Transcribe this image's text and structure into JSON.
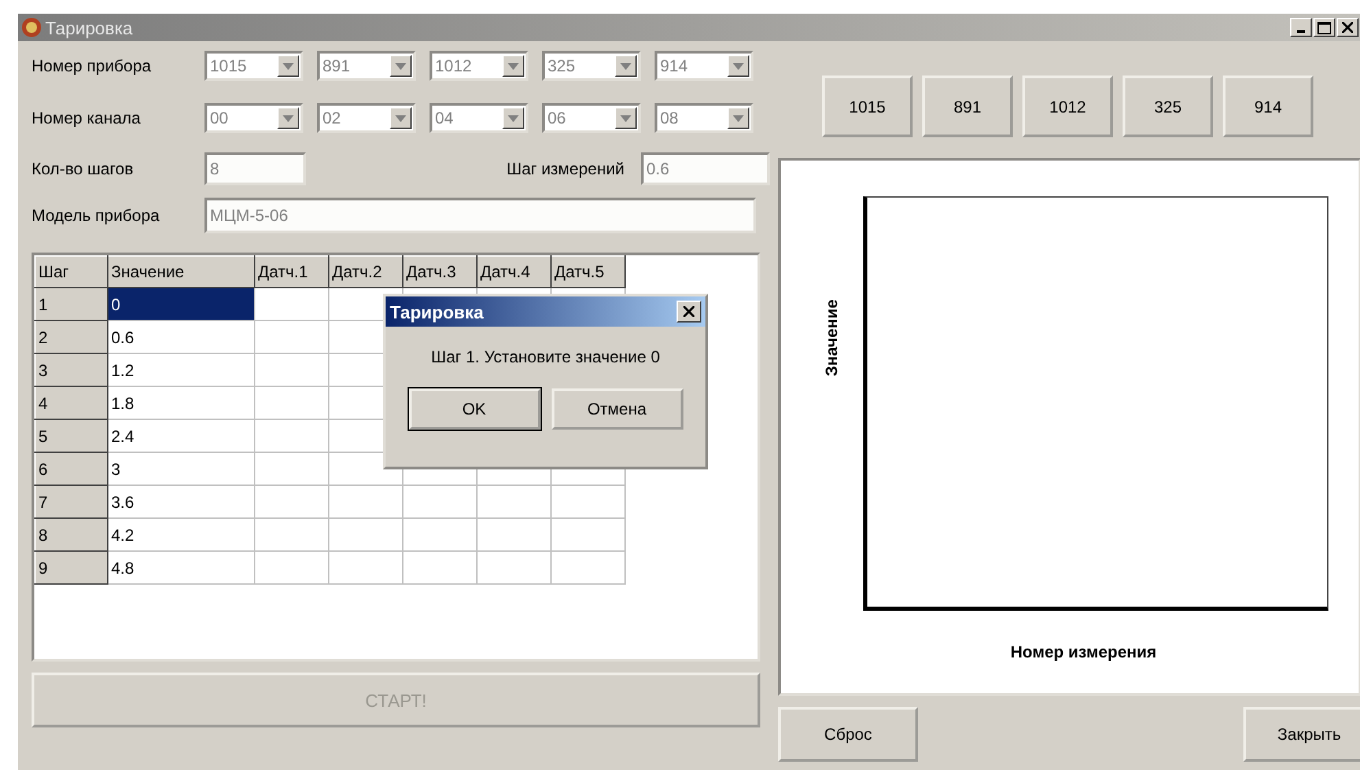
{
  "window": {
    "title": "Тарировка"
  },
  "device_row": {
    "label": "Номер прибора",
    "combos": [
      {
        "value": "1015"
      },
      {
        "value": "891"
      },
      {
        "value": "1012"
      },
      {
        "value": "325"
      },
      {
        "value": "914"
      }
    ]
  },
  "channel_row": {
    "label": "Номер канала",
    "combos": [
      {
        "value": "00"
      },
      {
        "value": "02"
      },
      {
        "value": "04"
      },
      {
        "value": "06"
      },
      {
        "value": "08"
      }
    ]
  },
  "steps_count": {
    "label": "Кол-во шагов",
    "value": "8",
    "disabled": true
  },
  "measure_step": {
    "label": "Шаг измерений",
    "value": "0.6",
    "disabled": true
  },
  "model": {
    "label": "Модель прибора",
    "value": "МЦМ-5-06",
    "disabled": true
  },
  "table": {
    "columns": [
      "Шаг",
      "Значение",
      "Датч.1",
      "Датч.2",
      "Датч.3",
      "Датч.4",
      "Датч.5"
    ],
    "rows": [
      {
        "step": "1",
        "value": "0",
        "selected": true
      },
      {
        "step": "2",
        "value": "0.6",
        "selected": false
      },
      {
        "step": "3",
        "value": "1.2",
        "selected": false
      },
      {
        "step": "4",
        "value": "1.8",
        "selected": false
      },
      {
        "step": "5",
        "value": "2.4",
        "selected": false
      },
      {
        "step": "6",
        "value": "3",
        "selected": false
      },
      {
        "step": "7",
        "value": "3.6",
        "selected": false
      },
      {
        "step": "8",
        "value": "4.2",
        "selected": false
      },
      {
        "step": "9",
        "value": "4.8",
        "selected": false
      }
    ]
  },
  "dialog": {
    "title": "Тарировка",
    "message": "Шаг 1. Установите значение 0",
    "buttons": [
      {
        "label": "OK",
        "default": true
      },
      {
        "label": "Отмена",
        "default": false
      }
    ]
  },
  "start_button": {
    "label": "СТАРТ!",
    "disabled": true
  },
  "device_buttons": [
    "1015",
    "891",
    "1012",
    "325",
    "914"
  ],
  "chart": {
    "ylabel": "Значение",
    "xlabel": "Номер измерения"
  },
  "reset_button": "Сброс",
  "close_button": "Закрыть"
}
